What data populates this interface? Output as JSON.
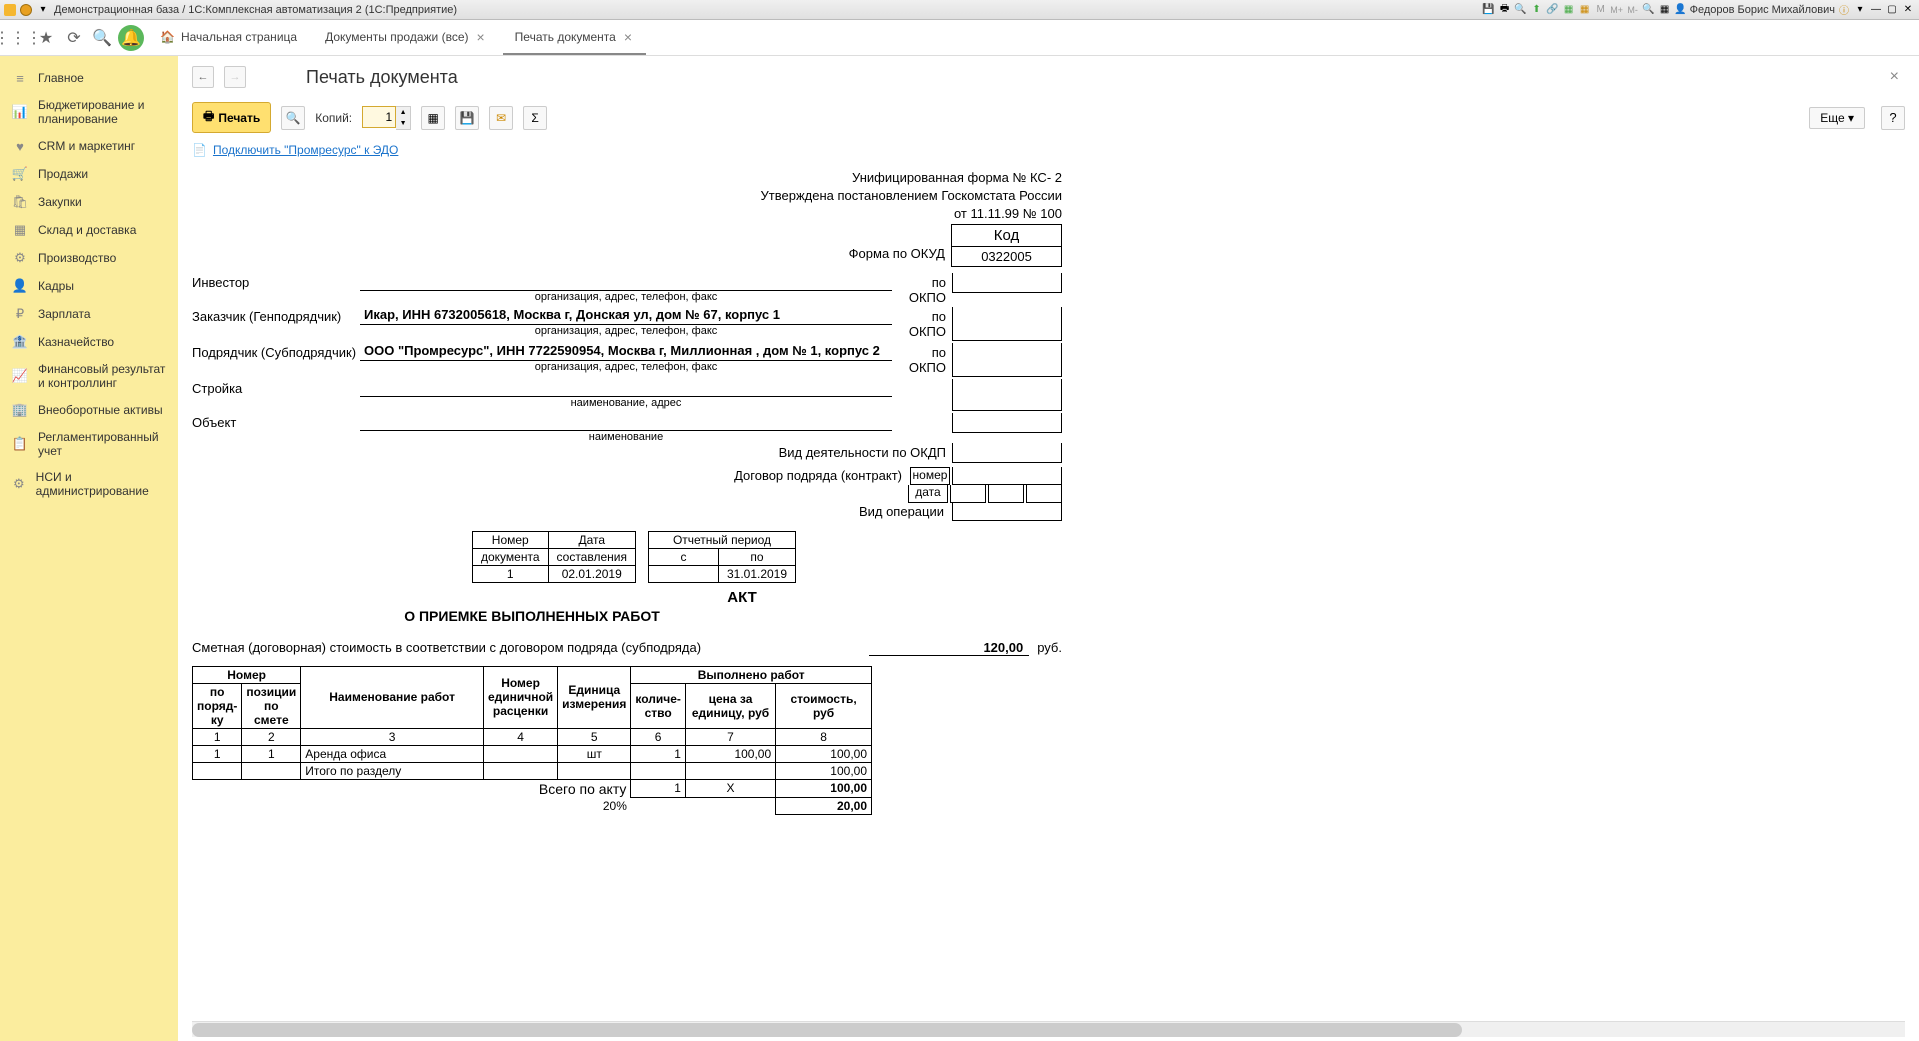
{
  "titlebar": {
    "title": "Демонстрационная база / 1С:Комплексная автоматизация 2  (1С:Предприятие)",
    "user": "Федоров Борис Михайлович"
  },
  "tabs": [
    {
      "label": "Начальная страница",
      "icon": "home"
    },
    {
      "label": "Документы продажи (все)",
      "close": true
    },
    {
      "label": "Печать документа",
      "close": true,
      "active": true
    }
  ],
  "sidebar": [
    {
      "icon": "≡",
      "label": "Главное"
    },
    {
      "icon": "📊",
      "label": "Бюджетирование и планирование"
    },
    {
      "icon": "♥",
      "label": "CRM и маркетинг"
    },
    {
      "icon": "🛒",
      "label": "Продажи"
    },
    {
      "icon": "🛍",
      "label": "Закупки"
    },
    {
      "icon": "▦",
      "label": "Склад и доставка"
    },
    {
      "icon": "⚙",
      "label": "Производство"
    },
    {
      "icon": "👤",
      "label": "Кадры"
    },
    {
      "icon": "₽",
      "label": "Зарплата"
    },
    {
      "icon": "🏦",
      "label": "Казначейство"
    },
    {
      "icon": "📈",
      "label": "Финансовый результат и контроллинг"
    },
    {
      "icon": "🏢",
      "label": "Внеоборотные активы"
    },
    {
      "icon": "📋",
      "label": "Регламентированный учет"
    },
    {
      "icon": "⚙",
      "label": "НСИ и администрирование"
    }
  ],
  "page": {
    "title": "Печать документа"
  },
  "toolbar": {
    "print": "Печать",
    "copies_label": "Копий:",
    "copies_value": "1",
    "more": "Еще"
  },
  "edo": {
    "link": "Подключить \"Промресурс\" к ЭДО"
  },
  "doc": {
    "form_line1": "Унифицированная форма № КС- 2",
    "form_line2": "Утверждена постановлением Госкомстата России",
    "form_line3": "от 11.11.99 № 100",
    "code_header": "Код",
    "okud_label": "Форма по ОКУД",
    "okud": "0322005",
    "investor_lbl": "Инвестор",
    "okpo": "по ОКПО",
    "info_note": "организация, адрес, телефон, факс",
    "customer_lbl": "Заказчик (Генподрядчик)",
    "customer": "Икар, ИНН 6732005618, Москва г, Донская ул, дом № 67, корпус 1",
    "contractor_lbl": "Подрядчик (Субподрядчик)",
    "contractor": "ООО \"Промресурс\", ИНН 7722590954, Москва г, Миллионная , дом № 1, корпус 2",
    "site_lbl": "Стройка",
    "site_note": "наименование, адрес",
    "object_lbl": "Объект",
    "object_note": "наименование",
    "okdp_lbl": "Вид деятельности по ОКДП",
    "contract_lbl": "Договор подряда (контракт)",
    "contract_num": "номер",
    "contract_date": "дата",
    "op_lbl": "Вид операции",
    "meta": {
      "doc_num_h1": "Номер",
      "doc_num_h2": "документа",
      "date_h1": "Дата",
      "date_h2": "составления",
      "period_h": "Отчетный период",
      "from": "с",
      "to": "по",
      "num": "1",
      "date": "02.01.2019",
      "period_to": "31.01.2019"
    },
    "act_title": "АКТ",
    "act_sub": "О ПРИЕМКЕ ВЫПОЛНЕННЫХ РАБОТ",
    "cost_lbl": "Сметная (договорная) стоимость в соответствии с договором подряда (субподряда)",
    "cost_val": "120,00",
    "rub": "руб.",
    "table": {
      "h_num": "Номер",
      "h_order": "по поряд-ку",
      "h_pos": "позиции по смете",
      "h_work": "Наименование работ",
      "h_price": "Номер единичной расценки",
      "h_unit": "Единица измерения",
      "h_done": "Выполнено работ",
      "h_qty": "количе-ство",
      "h_unit_price": "цена за единицу, руб",
      "h_cost": "стоимость,   руб",
      "cols": [
        "1",
        "2",
        "3",
        "4",
        "5",
        "6",
        "7",
        "8"
      ],
      "rows": [
        {
          "n": "1",
          "pos": "1",
          "name": "Аренда офиса",
          "unit": "шт",
          "qty": "1",
          "price": "100,00",
          "cost": "100,00"
        }
      ],
      "subtotal_lbl": "Итого по разделу",
      "subtotal": "100,00",
      "total_lbl": "Всего по акту",
      "total_qty": "1",
      "total_x": "X",
      "total": "100,00",
      "vat_lbl": "20%",
      "vat": "20,00"
    }
  }
}
